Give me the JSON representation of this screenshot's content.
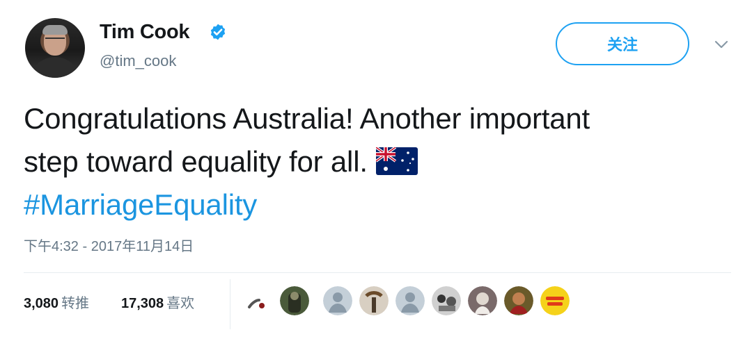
{
  "user": {
    "display_name": "Tim Cook",
    "username": "@tim_cook",
    "verified": true,
    "avatar_icon": "profile-photo"
  },
  "header": {
    "follow_label": "关注",
    "menu_icon": "chevron-down-icon"
  },
  "tweet": {
    "line1": "Congratulations Australia! Another important",
    "line2": "step toward equality for all.",
    "flag": "australia-flag-icon",
    "hashtag": "#MarriageEquality"
  },
  "timestamp": "下午4:32 - 2017年11月14日",
  "stats": {
    "retweets_count": "3,080",
    "retweets_label": "转推",
    "likes_count": "17,308",
    "likes_label": "喜欢"
  },
  "likers": [
    "liker-avatar-1",
    "liker-avatar-2",
    "liker-avatar-3",
    "liker-avatar-4",
    "liker-avatar-5",
    "liker-avatar-6",
    "liker-avatar-7",
    "liker-avatar-8",
    "liker-avatar-9"
  ],
  "colors": {
    "accent": "#1da1f2",
    "hashtag": "#1b95e0",
    "secondary_text": "#657786",
    "primary_text": "#14171a"
  }
}
